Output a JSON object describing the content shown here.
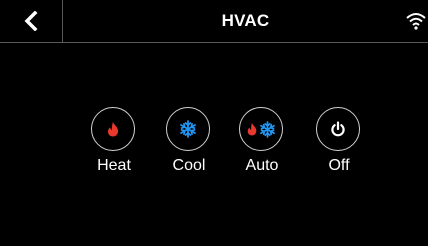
{
  "header": {
    "title": "HVAC",
    "back_icon": "chevron-left-icon",
    "status_icon": "wifi-icon"
  },
  "modes": [
    {
      "id": "heat",
      "label": "Heat",
      "icon": "flame-icon",
      "color": "#e8392c"
    },
    {
      "id": "cool",
      "label": "Cool",
      "icon": "snowflake-icon",
      "color": "#2196f3"
    },
    {
      "id": "auto",
      "label": "Auto",
      "icon": "flame-snowflake-icon",
      "color": "#e8392c"
    },
    {
      "id": "off",
      "label": "Off",
      "icon": "power-icon",
      "color": "#ffffff"
    }
  ],
  "colors": {
    "background": "#000000",
    "heat": "#e8392c",
    "cool": "#2196f3",
    "divider": "#5a5a5a"
  }
}
